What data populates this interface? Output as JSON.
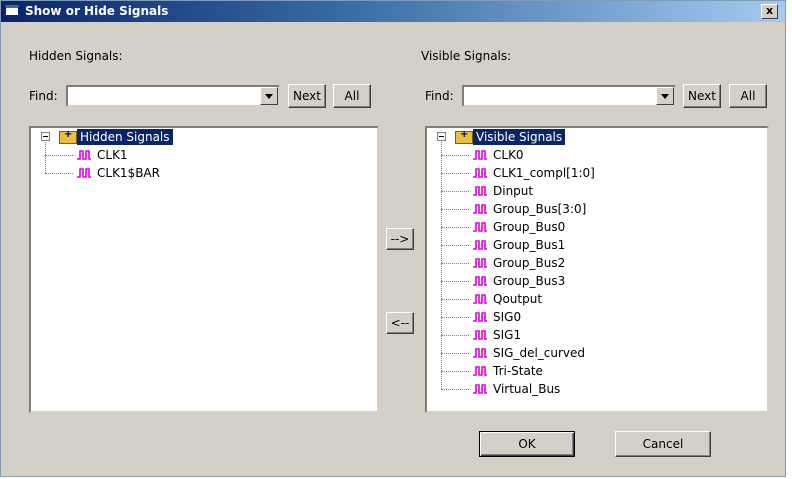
{
  "window": {
    "title": "Show or Hide Signals",
    "close_label": "x"
  },
  "hidden": {
    "heading": "Hidden Signals:",
    "find_label": "Find:",
    "find_value": "",
    "next_label": "Next",
    "all_label": "All",
    "root_label": "Hidden Signals",
    "items": [
      "CLK1",
      "CLK1$BAR"
    ]
  },
  "visible": {
    "heading": "Visible Signals:",
    "find_label": "Find:",
    "find_value": "",
    "next_label": "Next",
    "all_label": "All",
    "root_label": "Visible Signals",
    "items": [
      "CLK0",
      "CLK1_compl[1:0]",
      "Dinput",
      "Group_Bus[3:0]",
      "Group_Bus0",
      "Group_Bus1",
      "Group_Bus2",
      "Group_Bus3",
      "Qoutput",
      "SIG0",
      "SIG1",
      "SIG_del_curved",
      "Tri-State",
      "Virtual_Bus"
    ]
  },
  "move_right_label": "-->",
  "move_left_label": "<--",
  "ok_label": "OK",
  "cancel_label": "Cancel",
  "colors": {
    "signal_icon": "#e000e0",
    "selection": "#0a246a"
  }
}
